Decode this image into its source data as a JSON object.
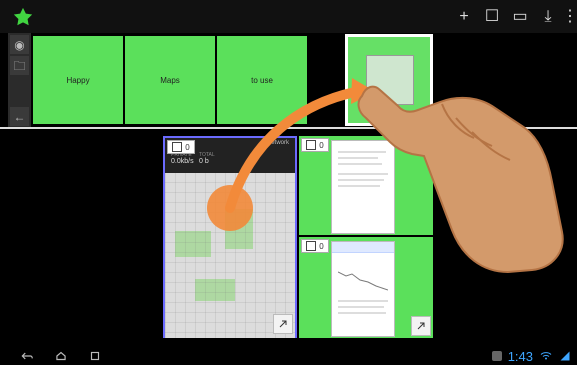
{
  "window": {
    "title": ""
  },
  "top_toolbar": {
    "star_icon": "star-icon",
    "actions": [
      {
        "name": "add-icon",
        "glyph": "+"
      },
      {
        "name": "square-icon",
        "glyph": "☐"
      },
      {
        "name": "card-icon",
        "glyph": "▭"
      },
      {
        "name": "download-icon",
        "glyph": "⤓"
      },
      {
        "name": "overflow-menu-icon",
        "glyph": "⋮"
      }
    ]
  },
  "left_toolbar": {
    "items": [
      {
        "name": "circle-icon",
        "glyph": "◉"
      },
      {
        "name": "folder-icon",
        "glyph": "🗀"
      },
      {
        "name": "back-arrow-icon",
        "glyph": "←"
      }
    ]
  },
  "row1": {
    "cards": [
      {
        "label": "Happy"
      },
      {
        "label": "Maps"
      },
      {
        "label": "to use"
      }
    ]
  },
  "lower": {
    "panel_left": {
      "chip_count": "0",
      "header_text": "network",
      "stats": [
        {
          "label": "PRIVATE",
          "value": "0.0kb/s"
        },
        {
          "label": "TOTAL",
          "value": "0 b"
        }
      ]
    },
    "panel_right_top": {
      "chip_count": "0"
    },
    "panel_right_bottom": {
      "chip_count": "0"
    }
  },
  "status_bar": {
    "time": "1:43"
  },
  "colors": {
    "accent_green": "#5be05b",
    "selected_border": "#6b6bff",
    "gesture_orange": "#f28a3a",
    "hand": "#d39a6b",
    "status_blue": "#3ea6ff"
  }
}
